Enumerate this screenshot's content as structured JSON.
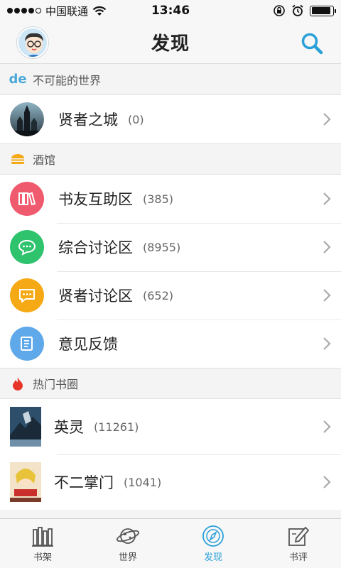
{
  "status": {
    "carrier": "中国联通",
    "time": "13:46"
  },
  "header": {
    "title": "发现"
  },
  "sections": [
    {
      "title": "不可能的世界",
      "icon": "de-logo-icon"
    },
    {
      "title": "酒馆",
      "icon": "burger-icon"
    },
    {
      "title": "热门书圈",
      "icon": "flame-icon"
    }
  ],
  "world": {
    "label": "贤者之城",
    "count": "(0)"
  },
  "tavern": [
    {
      "label": "书友互助区",
      "count": "(385)",
      "color": "#f05a6e",
      "icon": "books-icon"
    },
    {
      "label": "综合讨论区",
      "count": "(8955)",
      "color": "#2fc36e",
      "icon": "chat-bubble-icon"
    },
    {
      "label": "贤者讨论区",
      "count": "(652)",
      "color": "#f5a914",
      "icon": "message-icon"
    },
    {
      "label": "意见反馈",
      "count": "",
      "color": "#5fa9ea",
      "icon": "document-icon"
    }
  ],
  "hot": [
    {
      "label": "英灵",
      "count": "(11261)"
    },
    {
      "label": "不二掌门",
      "count": "(1041)"
    }
  ],
  "tabs": [
    {
      "label": "书架",
      "icon": "bookshelf-icon"
    },
    {
      "label": "世界",
      "icon": "planet-icon"
    },
    {
      "label": "发现",
      "icon": "compass-icon"
    },
    {
      "label": "书评",
      "icon": "pen-icon"
    }
  ],
  "colors": {
    "accent": "#2aa0d8"
  }
}
